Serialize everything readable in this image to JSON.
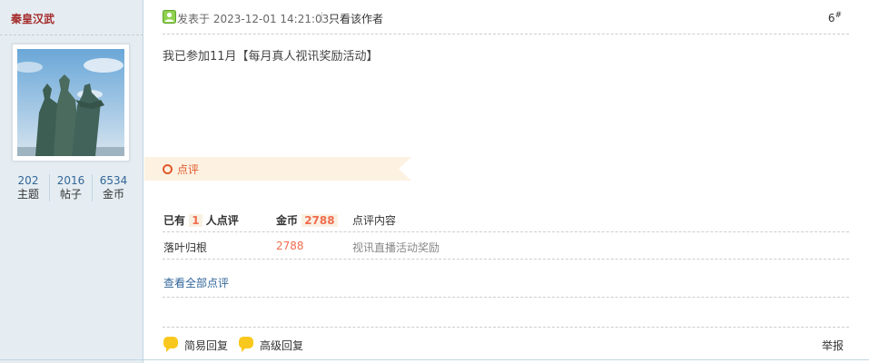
{
  "author": {
    "username": "秦皇汉武",
    "stats": [
      {
        "value": "202",
        "label": "主题"
      },
      {
        "value": "2016",
        "label": "帖子"
      },
      {
        "value": "6534",
        "label": "金币"
      }
    ]
  },
  "post": {
    "posted_prefix": "发表于",
    "posted_time": "2023-12-01 14:21:03",
    "author_only": "只看该作者",
    "floor": "6",
    "floor_sup": "#",
    "content": "我已参加11月【每月真人视讯奖励活动】"
  },
  "rating": {
    "banner_label": "点评",
    "header": {
      "prefix": "已有",
      "count": "1",
      "suffix": "人点评",
      "gold_label": "金币",
      "gold_total": "2788",
      "comment_label": "点评内容"
    },
    "rows": [
      {
        "user": "落叶归根",
        "amount": "2788",
        "comment": "视讯直播活动奖励"
      }
    ],
    "view_all": "查看全部点评"
  },
  "footer": {
    "quick_reply": "简易回复",
    "advanced_reply": "高级回复",
    "report": "举报"
  }
}
